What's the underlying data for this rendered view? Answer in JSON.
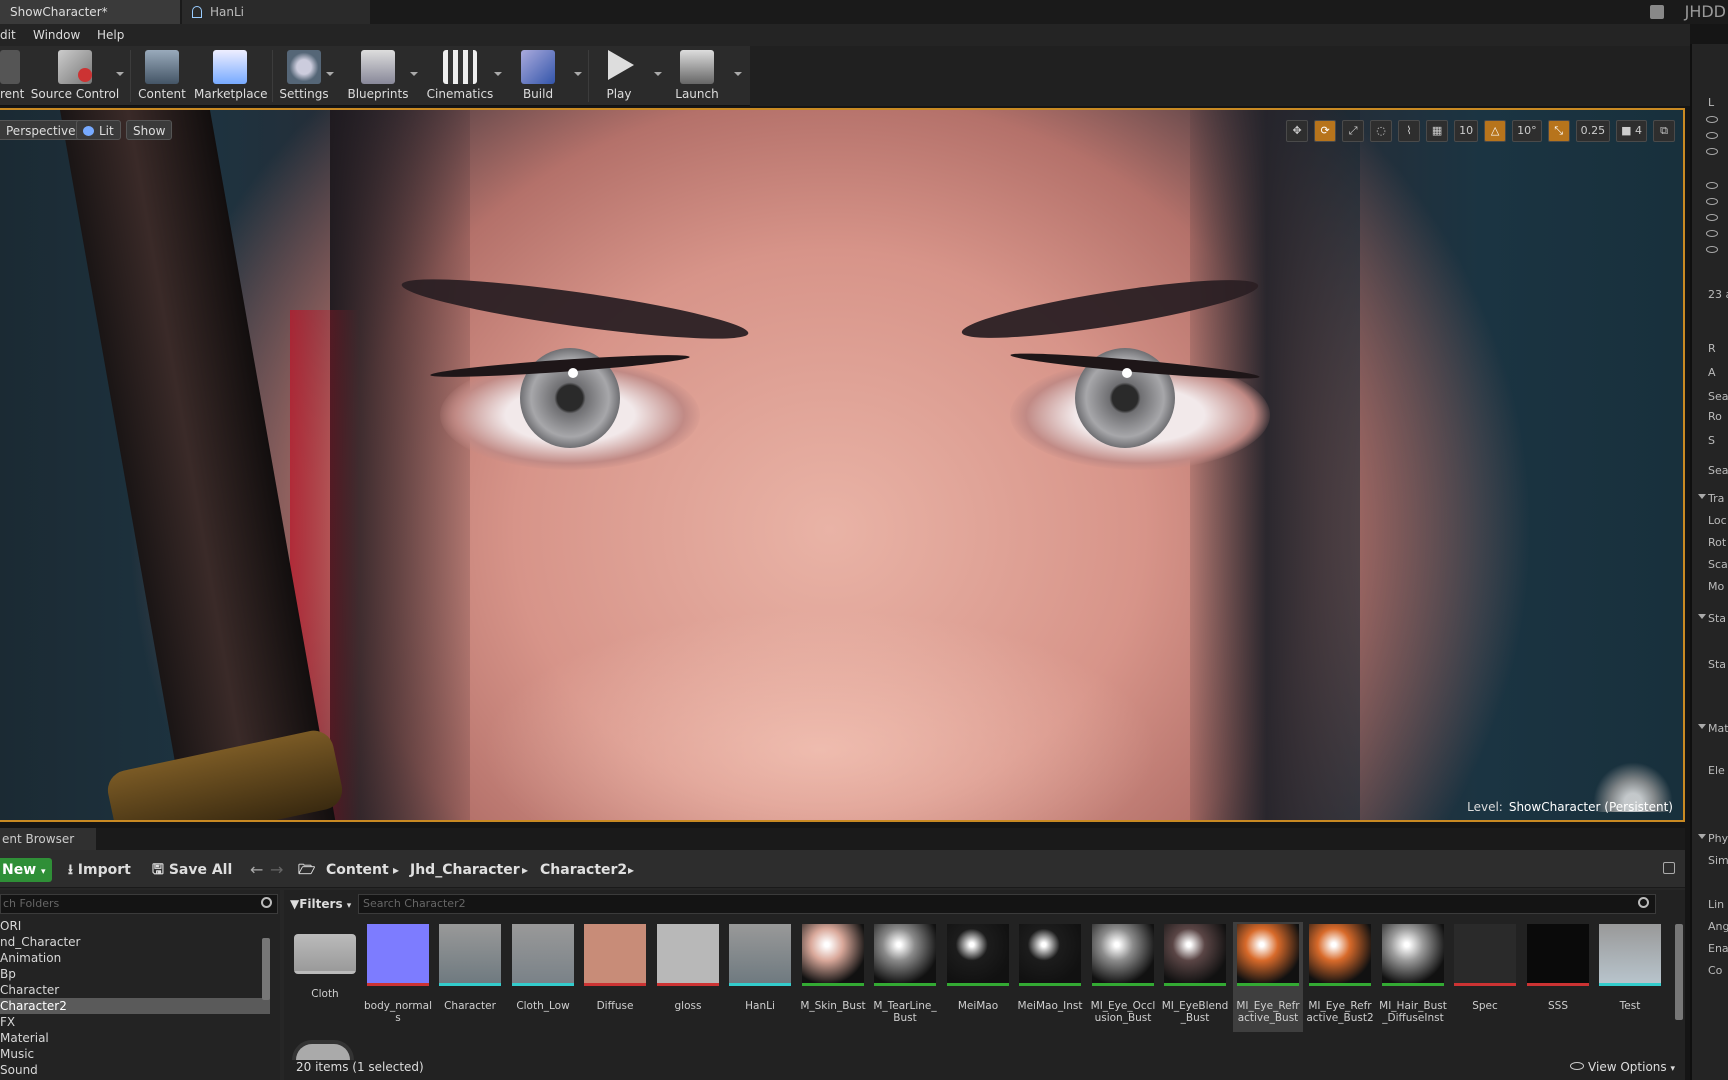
{
  "window": {
    "tabs": [
      {
        "label": "ShowCharacter*"
      },
      {
        "label": "HanLi"
      }
    ],
    "title_right": "JHDD"
  },
  "menu": {
    "items": [
      "dit",
      "Window",
      "Help"
    ]
  },
  "toolbar": {
    "buttons": [
      {
        "label": "rent",
        "icon": "current-icon"
      },
      {
        "label": "Source Control",
        "icon": "source-control-icon"
      },
      {
        "label": "Content",
        "icon": "content-icon"
      },
      {
        "label": "Marketplace",
        "icon": "marketplace-icon"
      },
      {
        "label": "Settings",
        "icon": "settings-icon"
      },
      {
        "label": "Blueprints",
        "icon": "blueprints-icon"
      },
      {
        "label": "Cinematics",
        "icon": "cinematics-icon"
      },
      {
        "label": "Build",
        "icon": "build-icon"
      },
      {
        "label": "Play",
        "icon": "play-icon"
      },
      {
        "label": "Launch",
        "icon": "launch-icon"
      }
    ]
  },
  "viewport": {
    "perspective_label": "Perspective",
    "lit_label": "Lit",
    "show_label": "Show",
    "grid_snap": "10",
    "rotation_snap": "10°",
    "scale_snap": "0.25",
    "camera_speed": "4",
    "level_prefix": "Level:",
    "level_name": "ShowCharacter (Persistent)"
  },
  "content_browser": {
    "tab_label": "ent Browser",
    "new_label": "New",
    "import_label": "Import",
    "save_all_label": "Save All",
    "breadcrumb": [
      "Content",
      "Jhd_Character",
      "Character2"
    ],
    "folder_search_placeholder": "ch Folders",
    "folders": [
      {
        "label": "ORI",
        "selected": false
      },
      {
        "label": "nd_Character",
        "selected": false
      },
      {
        "label": "Animation",
        "selected": false
      },
      {
        "label": "Bp",
        "selected": false
      },
      {
        "label": "Character",
        "selected": false
      },
      {
        "label": "Character2",
        "selected": true
      },
      {
        "label": "FX",
        "selected": false
      },
      {
        "label": "Material",
        "selected": false
      },
      {
        "label": "Music",
        "selected": false
      },
      {
        "label": "Sound",
        "selected": false
      }
    ],
    "filters_label": "Filters",
    "asset_search_placeholder": "Search Character2",
    "assets": [
      {
        "label": "Cloth",
        "color": "#9a9a9a",
        "kind": "folder"
      },
      {
        "label": "body_normals",
        "color": "#7d7cff",
        "kind": "texture"
      },
      {
        "label": "Character",
        "color": "#6f7a80",
        "kind": "skeletal-mesh"
      },
      {
        "label": "Cloth_Low",
        "color": "#7a8288",
        "kind": "skeletal-mesh"
      },
      {
        "label": "Diffuse",
        "color": "#c88c78",
        "kind": "texture"
      },
      {
        "label": "gloss",
        "color": "#b8b8b8",
        "kind": "texture"
      },
      {
        "label": "HanLi",
        "color": "#6f7a80",
        "kind": "skeletal-mesh"
      },
      {
        "label": "M_Skin_Bust",
        "color": "#d9a89a",
        "kind": "material"
      },
      {
        "label": "M_TearLine_Bust",
        "color": "#8a8a8a",
        "kind": "material"
      },
      {
        "label": "MeiMao",
        "color": "#1c1c1c",
        "kind": "material"
      },
      {
        "label": "MeiMao_Inst",
        "color": "#1c1c1c",
        "kind": "material-instance"
      },
      {
        "label": "MI_Eye_Occlusion_Bust",
        "color": "#8c8c8c",
        "kind": "material-instance"
      },
      {
        "label": "MI_EyeBlend_Bust",
        "color": "#5a4545",
        "kind": "material-instance"
      },
      {
        "label": "MI_Eye_Refractive_Bust",
        "color": "#d86a2a",
        "kind": "material-instance"
      },
      {
        "label": "MI_Eye_Refractive_Bust2",
        "color": "#d86a2a",
        "kind": "material-instance"
      },
      {
        "label": "MI_Hair_Bust_DiffuseInst",
        "color": "#9a9a9a",
        "kind": "material-instance"
      },
      {
        "label": "Spec",
        "color": "#2a2a2a",
        "kind": "texture"
      },
      {
        "label": "SSS",
        "color": "#0a0a0a",
        "kind": "texture"
      },
      {
        "label": "Test",
        "color": "#b8c4cc",
        "kind": "skeletal-mesh"
      }
    ],
    "status": "20 items (1 selected)",
    "view_options_label": "View Options"
  },
  "right_panel": {
    "items": [
      "L",
      "23 a",
      "R",
      "A",
      "Sear",
      "Ro",
      "S",
      "Sear",
      "Tra",
      "Loc",
      "Rot",
      "Sca",
      "Mo",
      "Sta",
      "Sta",
      "Mat",
      "Ele",
      "Phy",
      "Sim",
      "Lin",
      "Ang",
      "Ena",
      "Co"
    ]
  }
}
